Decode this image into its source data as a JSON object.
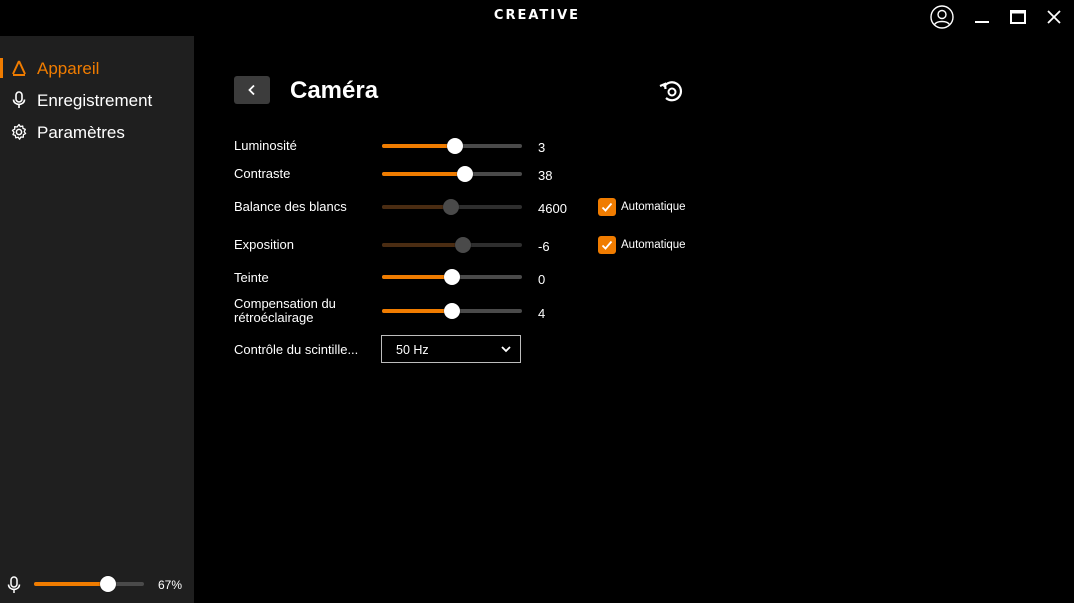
{
  "app": {
    "brand": "CREATIVE"
  },
  "sidebar": {
    "items": [
      {
        "label": "Appareil",
        "icon": "device-icon",
        "active": true
      },
      {
        "label": "Enregistrement",
        "icon": "microphone-icon",
        "active": false
      },
      {
        "label": "Paramètres",
        "icon": "gear-icon",
        "active": false
      }
    ],
    "mic": {
      "level_label": "67%",
      "level": 0.67
    }
  },
  "page": {
    "title": "Caméra"
  },
  "controls": {
    "brightness": {
      "label": "Luminosité",
      "value": "3",
      "position": 0.52
    },
    "contrast": {
      "label": "Contraste",
      "value": "38",
      "position": 0.59
    },
    "white_balance": {
      "label": "Balance des blancs",
      "value": "4600",
      "position": 0.49,
      "auto_label": "Automatique",
      "auto": true
    },
    "exposure": {
      "label": "Exposition",
      "value": "-6",
      "position": 0.58,
      "auto_label": "Automatique",
      "auto": true
    },
    "hue": {
      "label": "Teinte",
      "value": "0",
      "position": 0.5
    },
    "backlight": {
      "label_line1": "Compensation du",
      "label_line2": "rétroéclairage",
      "value": "4",
      "position": 0.5
    },
    "flicker": {
      "label": "Contrôle du scintille...",
      "selected": "50 Hz"
    }
  },
  "colors": {
    "accent": "#f07c00",
    "sidebar_bg": "#1f1f1f",
    "main_bg": "#000000"
  }
}
